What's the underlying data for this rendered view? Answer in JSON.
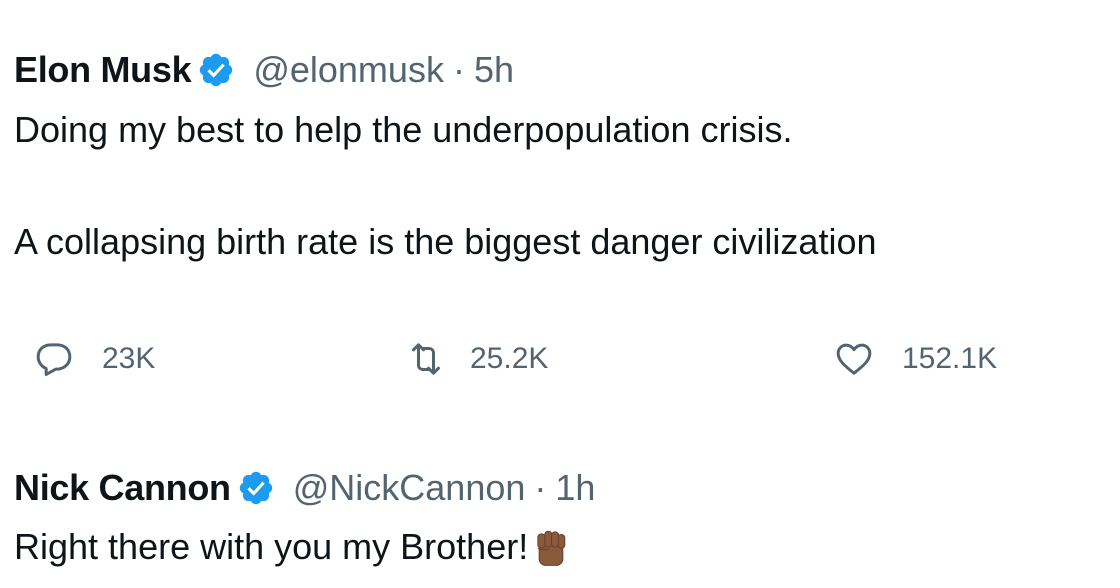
{
  "tweets": [
    {
      "name": "Elon Musk",
      "handle": "@elonmusk",
      "separator": "·",
      "time": "5h",
      "verified": true,
      "text_line1": "Doing my best to help the underpopulation crisis.",
      "text_line2": "A collapsing birth rate is the biggest danger civilization",
      "stats": {
        "replies": "23K",
        "retweets": "25.2K",
        "likes": "152.1K"
      }
    },
    {
      "name": "Nick Cannon",
      "handle": "@NickCannon",
      "separator": "·",
      "time": "1h",
      "verified": true,
      "text_line1": "Right there with you my Brother!",
      "emoji": "raised-fist-medium-dark-skin-tone"
    }
  ],
  "colors": {
    "verified_blue": "#1d9bf0",
    "secondary_text": "#536471",
    "primary_text": "#0f1419",
    "fist_skin": "#8a5a3c"
  },
  "icons": {
    "reply": "speech-bubble-icon",
    "retweet": "retweet-icon",
    "like": "heart-icon",
    "verified": "verified-badge-icon"
  }
}
